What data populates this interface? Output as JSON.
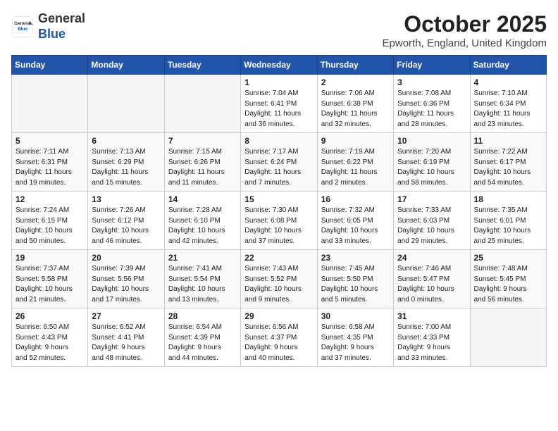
{
  "logo": {
    "general": "General",
    "blue": "Blue"
  },
  "header": {
    "month": "October 2025",
    "location": "Epworth, England, United Kingdom"
  },
  "weekdays": [
    "Sunday",
    "Monday",
    "Tuesday",
    "Wednesday",
    "Thursday",
    "Friday",
    "Saturday"
  ],
  "weeks": [
    [
      {
        "day": "",
        "info": ""
      },
      {
        "day": "",
        "info": ""
      },
      {
        "day": "",
        "info": ""
      },
      {
        "day": "1",
        "info": "Sunrise: 7:04 AM\nSunset: 6:41 PM\nDaylight: 11 hours\nand 36 minutes."
      },
      {
        "day": "2",
        "info": "Sunrise: 7:06 AM\nSunset: 6:38 PM\nDaylight: 11 hours\nand 32 minutes."
      },
      {
        "day": "3",
        "info": "Sunrise: 7:08 AM\nSunset: 6:36 PM\nDaylight: 11 hours\nand 28 minutes."
      },
      {
        "day": "4",
        "info": "Sunrise: 7:10 AM\nSunset: 6:34 PM\nDaylight: 11 hours\nand 23 minutes."
      }
    ],
    [
      {
        "day": "5",
        "info": "Sunrise: 7:11 AM\nSunset: 6:31 PM\nDaylight: 11 hours\nand 19 minutes."
      },
      {
        "day": "6",
        "info": "Sunrise: 7:13 AM\nSunset: 6:29 PM\nDaylight: 11 hours\nand 15 minutes."
      },
      {
        "day": "7",
        "info": "Sunrise: 7:15 AM\nSunset: 6:26 PM\nDaylight: 11 hours\nand 11 minutes."
      },
      {
        "day": "8",
        "info": "Sunrise: 7:17 AM\nSunset: 6:24 PM\nDaylight: 11 hours\nand 7 minutes."
      },
      {
        "day": "9",
        "info": "Sunrise: 7:19 AM\nSunset: 6:22 PM\nDaylight: 11 hours\nand 2 minutes."
      },
      {
        "day": "10",
        "info": "Sunrise: 7:20 AM\nSunset: 6:19 PM\nDaylight: 10 hours\nand 58 minutes."
      },
      {
        "day": "11",
        "info": "Sunrise: 7:22 AM\nSunset: 6:17 PM\nDaylight: 10 hours\nand 54 minutes."
      }
    ],
    [
      {
        "day": "12",
        "info": "Sunrise: 7:24 AM\nSunset: 6:15 PM\nDaylight: 10 hours\nand 50 minutes."
      },
      {
        "day": "13",
        "info": "Sunrise: 7:26 AM\nSunset: 6:12 PM\nDaylight: 10 hours\nand 46 minutes."
      },
      {
        "day": "14",
        "info": "Sunrise: 7:28 AM\nSunset: 6:10 PM\nDaylight: 10 hours\nand 42 minutes."
      },
      {
        "day": "15",
        "info": "Sunrise: 7:30 AM\nSunset: 6:08 PM\nDaylight: 10 hours\nand 37 minutes."
      },
      {
        "day": "16",
        "info": "Sunrise: 7:32 AM\nSunset: 6:05 PM\nDaylight: 10 hours\nand 33 minutes."
      },
      {
        "day": "17",
        "info": "Sunrise: 7:33 AM\nSunset: 6:03 PM\nDaylight: 10 hours\nand 29 minutes."
      },
      {
        "day": "18",
        "info": "Sunrise: 7:35 AM\nSunset: 6:01 PM\nDaylight: 10 hours\nand 25 minutes."
      }
    ],
    [
      {
        "day": "19",
        "info": "Sunrise: 7:37 AM\nSunset: 5:58 PM\nDaylight: 10 hours\nand 21 minutes."
      },
      {
        "day": "20",
        "info": "Sunrise: 7:39 AM\nSunset: 5:56 PM\nDaylight: 10 hours\nand 17 minutes."
      },
      {
        "day": "21",
        "info": "Sunrise: 7:41 AM\nSunset: 5:54 PM\nDaylight: 10 hours\nand 13 minutes."
      },
      {
        "day": "22",
        "info": "Sunrise: 7:43 AM\nSunset: 5:52 PM\nDaylight: 10 hours\nand 9 minutes."
      },
      {
        "day": "23",
        "info": "Sunrise: 7:45 AM\nSunset: 5:50 PM\nDaylight: 10 hours\nand 5 minutes."
      },
      {
        "day": "24",
        "info": "Sunrise: 7:46 AM\nSunset: 5:47 PM\nDaylight: 10 hours\nand 0 minutes."
      },
      {
        "day": "25",
        "info": "Sunrise: 7:48 AM\nSunset: 5:45 PM\nDaylight: 9 hours\nand 56 minutes."
      }
    ],
    [
      {
        "day": "26",
        "info": "Sunrise: 6:50 AM\nSunset: 4:43 PM\nDaylight: 9 hours\nand 52 minutes."
      },
      {
        "day": "27",
        "info": "Sunrise: 6:52 AM\nSunset: 4:41 PM\nDaylight: 9 hours\nand 48 minutes."
      },
      {
        "day": "28",
        "info": "Sunrise: 6:54 AM\nSunset: 4:39 PM\nDaylight: 9 hours\nand 44 minutes."
      },
      {
        "day": "29",
        "info": "Sunrise: 6:56 AM\nSunset: 4:37 PM\nDaylight: 9 hours\nand 40 minutes."
      },
      {
        "day": "30",
        "info": "Sunrise: 6:58 AM\nSunset: 4:35 PM\nDaylight: 9 hours\nand 37 minutes."
      },
      {
        "day": "31",
        "info": "Sunrise: 7:00 AM\nSunset: 4:33 PM\nDaylight: 9 hours\nand 33 minutes."
      },
      {
        "day": "",
        "info": ""
      }
    ]
  ]
}
